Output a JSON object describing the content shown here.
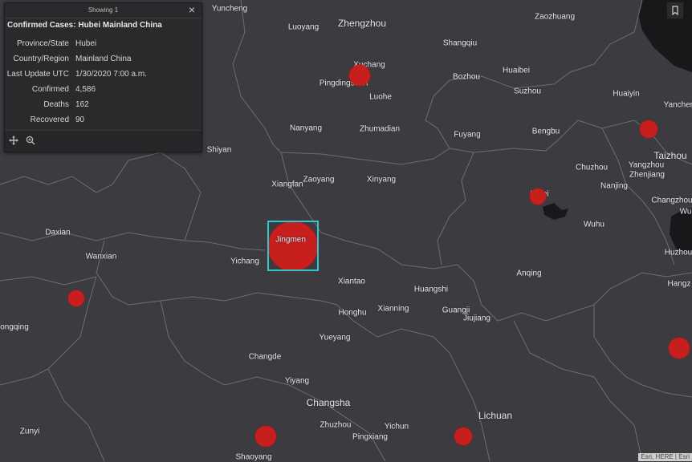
{
  "popup": {
    "showing": "Showing 1",
    "close": "×",
    "title": "Confirmed Cases: Hubei Mainland China",
    "fields": [
      {
        "label": "Province/State",
        "value": "Hubei"
      },
      {
        "label": "Country/Region",
        "value": "Mainland China"
      },
      {
        "label": "Last Update UTC",
        "value": "1/30/2020 7:00 a.m."
      },
      {
        "label": "Confirmed",
        "value": "4,586"
      },
      {
        "label": "Deaths",
        "value": "162"
      },
      {
        "label": "Recovered",
        "value": "90"
      }
    ],
    "footer_icons": [
      "move-icon",
      "zoom-to-icon"
    ]
  },
  "attribution": "Esri, HERE | Esri",
  "cities": {
    "yuncheng": "Yuncheng",
    "luoyang": "Luoyang",
    "zhengzhou": "Zhengzhou",
    "zaozhuang": "Zaozhuang",
    "shangqiu": "Shangqiu",
    "xuchang": "Xuchang",
    "pingdingshan": "Pingdingshan",
    "bozhou": "Bozhou",
    "huaibei": "Huaibei",
    "luohe": "Luohe",
    "suzhou": "Suzhou",
    "huaiyin": "Huaiyin",
    "yancheng": "Yanchen",
    "nanyang": "Nanyang",
    "zhumadian": "Zhumadian",
    "fuyang": "Fuyang",
    "bengbu": "Bengbu",
    "taizhou": "Taizhou",
    "shiyan": "Shiyan",
    "chuzhou": "Chuzhou",
    "yangzhou": "Yangzhou",
    "zhenjiang": "Zhenjiang",
    "xiangfan": "Xiangfan",
    "zaoyang": "Zaoyang",
    "xinyang": "Xinyang",
    "nanjing": "Nanjing",
    "hefei": "Hefei",
    "changzhou": "Changzhou",
    "wu": "Wu",
    "daxian": "Daxian",
    "jingmen": "Jingmen",
    "wuhu": "Wuhu",
    "wanxian": "Wanxian",
    "yichang": "Yichang",
    "huzhou": "Huzhou",
    "xiantao": "Xiantao",
    "huangshi": "Huangshi",
    "anqing": "Anqing",
    "hangzhou": "Hangz",
    "chongqing": "ongqing",
    "honghu": "Honghu",
    "xianning": "Xianning",
    "guangji": "Guangji",
    "jiujiang": "Jiujiang",
    "yueyang": "Yueyang",
    "changde": "Changde",
    "yiyang": "Yiyang",
    "changsha": "Changsha",
    "lichuan": "Lichuan",
    "zunyi": "Zunyi",
    "zhuzhou": "Zhuzhou",
    "yichun": "Yichun",
    "pingxiang": "Pingxiang",
    "shaoyang": "Shaoyang"
  },
  "colors": {
    "land": "#3c3c40",
    "water": "#18181a",
    "border": "#6e6e72",
    "marker": "#c71e1e",
    "selection": "#33c4cc"
  }
}
